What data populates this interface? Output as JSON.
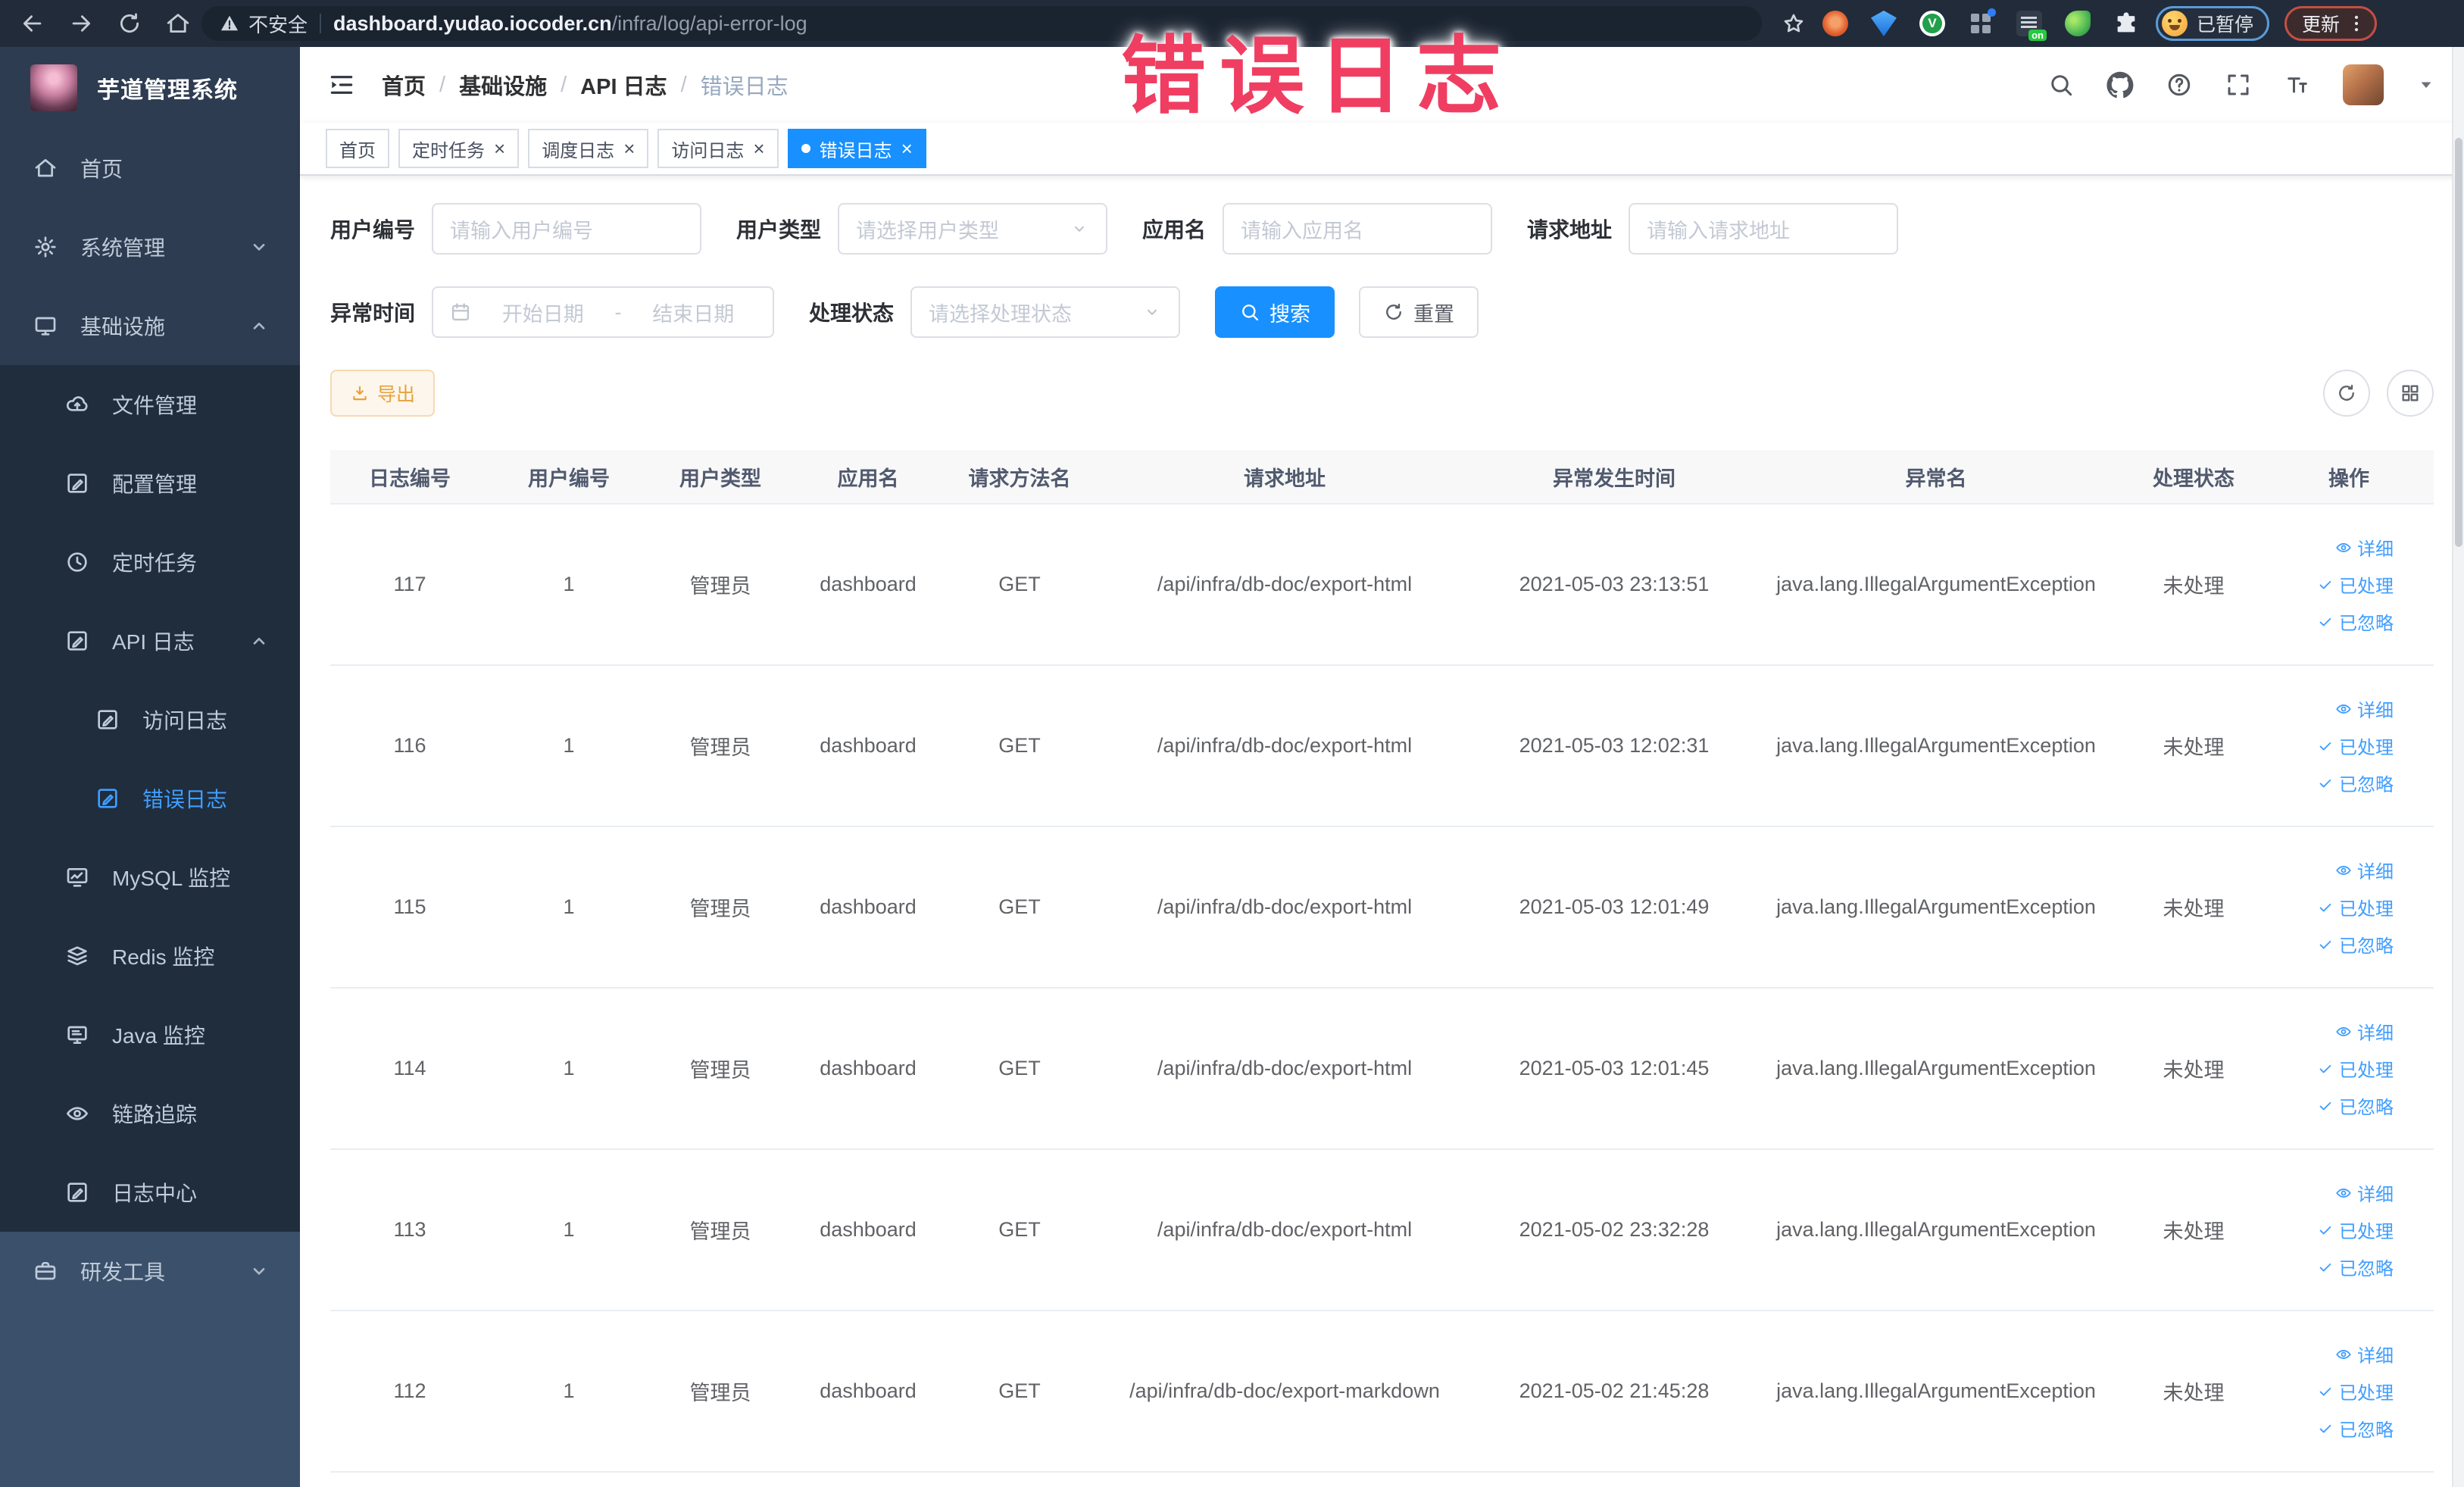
{
  "browser": {
    "security_label": "不安全",
    "url_host": "dashboard.yudao.iocoder.cn",
    "url_path": "/infra/log/api-error-log",
    "profile_status": "已暂停",
    "update_label": "更新"
  },
  "annotation": {
    "text": "错误日志",
    "color": "#ef3e61"
  },
  "sidebar": {
    "title": "芋道管理系统",
    "items": [
      {
        "label": "首页",
        "icon": "home",
        "level": 1
      },
      {
        "label": "系统管理",
        "icon": "gear",
        "level": 1,
        "chevron": "down"
      },
      {
        "label": "基础设施",
        "icon": "monitor",
        "level": 1,
        "chevron": "up"
      },
      {
        "label": "文件管理",
        "icon": "cloud",
        "level": 2
      },
      {
        "label": "配置管理",
        "icon": "edit",
        "level": 2
      },
      {
        "label": "定时任务",
        "icon": "clock",
        "level": 2
      },
      {
        "label": "API 日志",
        "icon": "edit",
        "level": 2,
        "chevron": "up"
      },
      {
        "label": "访问日志",
        "icon": "edit",
        "level": 3
      },
      {
        "label": "错误日志",
        "icon": "edit",
        "level": 3,
        "active": true
      },
      {
        "label": "MySQL 监控",
        "icon": "mysql",
        "level": 2
      },
      {
        "label": "Redis 监控",
        "icon": "redis",
        "level": 2
      },
      {
        "label": "Java 监控",
        "icon": "java",
        "level": 2
      },
      {
        "label": "链路追踪",
        "icon": "eye",
        "level": 2
      },
      {
        "label": "日志中心",
        "icon": "edit",
        "level": 2
      },
      {
        "label": "研发工具",
        "icon": "toolbox",
        "level": 1,
        "chevron": "down",
        "light": true
      }
    ]
  },
  "navbar": {
    "breadcrumb": [
      "首页",
      "基础设施",
      "API 日志",
      "错误日志"
    ]
  },
  "tags": [
    {
      "label": "首页"
    },
    {
      "label": "定时任务",
      "closable": true
    },
    {
      "label": "调度日志",
      "closable": true
    },
    {
      "label": "访问日志",
      "closable": true
    },
    {
      "label": "错误日志",
      "closable": true,
      "active": true
    }
  ],
  "filters": {
    "user_id": {
      "label": "用户编号",
      "placeholder": "请输入用户编号"
    },
    "user_type": {
      "label": "用户类型",
      "placeholder": "请选择用户类型"
    },
    "app_name": {
      "label": "应用名",
      "placeholder": "请输入应用名"
    },
    "request_url": {
      "label": "请求地址",
      "placeholder": "请输入请求地址"
    },
    "exception_time": {
      "label": "异常时间",
      "start_placeholder": "开始日期",
      "separator": "-",
      "end_placeholder": "结束日期"
    },
    "process_status": {
      "label": "处理状态",
      "placeholder": "请选择处理状态"
    },
    "search_button": "搜索",
    "reset_button": "重置"
  },
  "toolbar": {
    "export_button": "导出"
  },
  "table": {
    "columns": [
      "日志编号",
      "用户编号",
      "用户类型",
      "应用名",
      "请求方法名",
      "请求地址",
      "异常发生时间",
      "异常名",
      "处理状态",
      "操作"
    ],
    "actions": [
      "详细",
      "已处理",
      "已忽略"
    ],
    "rows": [
      [
        "117",
        "1",
        "管理员",
        "dashboard",
        "GET",
        "/api/infra/db-doc/export-html",
        "2021-05-03 23:13:51",
        "java.lang.IllegalArgumentException",
        "未处理"
      ],
      [
        "116",
        "1",
        "管理员",
        "dashboard",
        "GET",
        "/api/infra/db-doc/export-html",
        "2021-05-03 12:02:31",
        "java.lang.IllegalArgumentException",
        "未处理"
      ],
      [
        "115",
        "1",
        "管理员",
        "dashboard",
        "GET",
        "/api/infra/db-doc/export-html",
        "2021-05-03 12:01:49",
        "java.lang.IllegalArgumentException",
        "未处理"
      ],
      [
        "114",
        "1",
        "管理员",
        "dashboard",
        "GET",
        "/api/infra/db-doc/export-html",
        "2021-05-03 12:01:45",
        "java.lang.IllegalArgumentException",
        "未处理"
      ],
      [
        "113",
        "1",
        "管理员",
        "dashboard",
        "GET",
        "/api/infra/db-doc/export-html",
        "2021-05-02 23:32:28",
        "java.lang.IllegalArgumentException",
        "未处理"
      ],
      [
        "112",
        "1",
        "管理员",
        "dashboard",
        "GET",
        "/api/infra/db-doc/export-markdown",
        "2021-05-02 21:45:28",
        "java.lang.IllegalArgumentException",
        "未处理"
      ]
    ]
  },
  "colors": {
    "accent": "#1890ff",
    "link": "#409eff",
    "warning": "#e6a23c",
    "sidebar": "#2e3c51",
    "submenu": "#1f2d3d"
  }
}
